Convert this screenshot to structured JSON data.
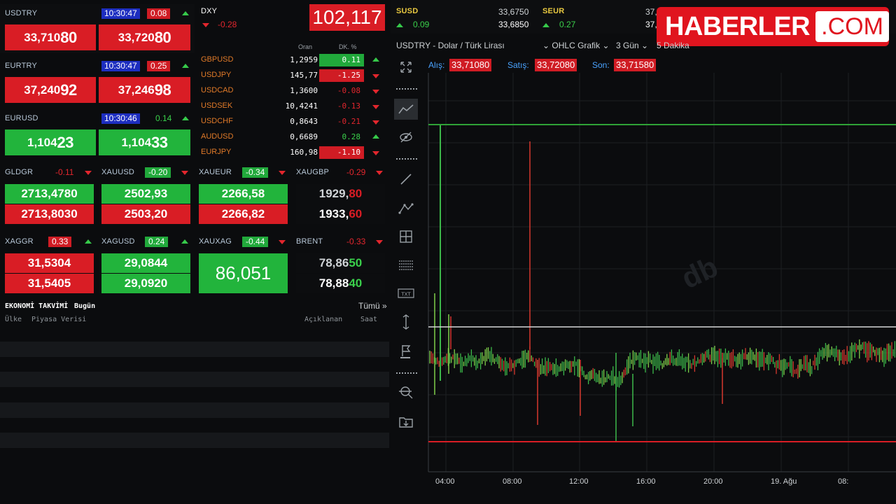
{
  "usdtry": {
    "symbol": "USDTRY",
    "time": "10:30:47",
    "change": "0.08",
    "bid_main": "33,710",
    "bid_tail": "80",
    "ask_main": "33,720",
    "ask_tail": "80"
  },
  "eurtry": {
    "symbol": "EURTRY",
    "time": "10:30:47",
    "change": "0.25",
    "bid_main": "37,240",
    "bid_tail": "92",
    "ask_main": "37,246",
    "ask_tail": "98"
  },
  "eurusd": {
    "symbol": "EURUSD",
    "time": "10:30:46",
    "change": "0.14",
    "bid_main": "1,104",
    "bid_tail": "23",
    "ask_main": "1,104",
    "ask_tail": "33"
  },
  "dxy": {
    "symbol": "DXY",
    "change": "-0.28",
    "value": "102,117"
  },
  "fx_header": {
    "oran": "Oran",
    "dk": "DK. %"
  },
  "fx_pairs": [
    {
      "name": "GBPUSD",
      "rate": "1,2959",
      "change": "0.11",
      "style": "green",
      "dir": "up"
    },
    {
      "name": "USDJPY",
      "rate": "145,77",
      "change": "-1.25",
      "style": "red",
      "dir": "down"
    },
    {
      "name": "USDCAD",
      "rate": "1,3600",
      "change": "-0.08",
      "style": "redtxt",
      "dir": "down"
    },
    {
      "name": "USDSEK",
      "rate": "10,4241",
      "change": "-0.13",
      "style": "redtxt",
      "dir": "down"
    },
    {
      "name": "USDCHF",
      "rate": "0,8643",
      "change": "-0.21",
      "style": "redtxt",
      "dir": "down"
    },
    {
      "name": "AUDUSD",
      "rate": "0,6689",
      "change": "0.28",
      "style": "greentxt",
      "dir": "up"
    },
    {
      "name": "EURJPY",
      "rate": "160,98",
      "change": "-1.10",
      "style": "red",
      "dir": "down"
    }
  ],
  "metals1": [
    {
      "symbol": "GLDGR",
      "change": "-0.11",
      "bid": "2713,4780",
      "ask": "2713,8030"
    },
    {
      "symbol": "XAUUSD",
      "change": "-0.20",
      "bid": "2502,93",
      "ask": "2503,20"
    },
    {
      "symbol": "XAUEUR",
      "change": "-0.34",
      "bid": "2266,58",
      "ask": "2266,82"
    },
    {
      "symbol": "XAUGBP",
      "change": "-0.29",
      "bid_main": "1929,",
      "bid_tail": "80",
      "ask_main": "1933,",
      "ask_tail": "60"
    }
  ],
  "metals2": [
    {
      "symbol": "XAGGR",
      "change": "0.33",
      "bid": "31,5304",
      "ask": "31,5405"
    },
    {
      "symbol": "XAGUSD",
      "change": "0.24",
      "bid": "29,0844",
      "ask": "29,0920"
    },
    {
      "symbol": "XAUXAG",
      "change": "-0.44",
      "value": "86,051"
    },
    {
      "symbol": "BRENT",
      "change": "-0.33",
      "bid_main": "78,86",
      "bid_tail": "50",
      "ask_main": "78,88",
      "ask_tail": "40"
    }
  ],
  "calendar": {
    "title": "EKONOMİ TAKVİMİ",
    "today": "Bugün",
    "all": "Tümü »",
    "col_country": "Ülke",
    "col_data": "Piyasa Verisi",
    "col_announced": "Açıklanan",
    "col_time": "Saat"
  },
  "susd": {
    "symbol": "SUSD",
    "change": "0.09",
    "bid": "33,6750",
    "ask": "33,6850"
  },
  "seur": {
    "symbol": "SEUR",
    "change": "0.27",
    "bid": "37,0",
    "ask": "37,"
  },
  "brand": {
    "name": "HABERLER",
    "domain": ".COM"
  },
  "chart_toolbar": {
    "title": "USDTRY - Dolar / Türk Lirası",
    "type": "OHLC Grafik",
    "range": "3 Gün",
    "interval": "5 Dakika"
  },
  "quote_bar": {
    "alis_label": "Alış:",
    "alis": "33,71080",
    "satis_label": "Satış:",
    "satis": "33,72080",
    "son_label": "Son:",
    "son": "33,71580"
  },
  "watermark": "db",
  "colors": {
    "up": "#22b43c",
    "down": "#d91d25",
    "time_bg": "#1d2ec0",
    "brand_red": "#e0141e",
    "fx_name": "#e07a28"
  },
  "chart_data": {
    "type": "line",
    "title": "USDTRY - Dolar / Türk Lirası",
    "x_tick_labels": [
      "04:00",
      "08:00",
      "12:00",
      "16:00",
      "20:00",
      "19. Ağu",
      "08:"
    ],
    "series": []
  }
}
